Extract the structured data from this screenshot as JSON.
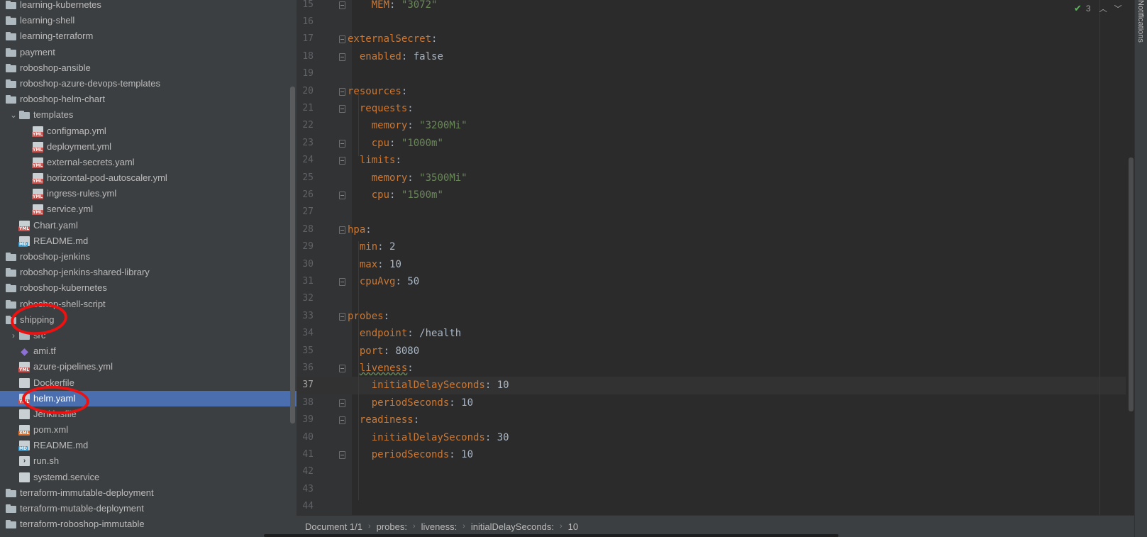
{
  "tree": {
    "rows": [
      {
        "label": "learning-kubernetes",
        "type": "folder",
        "depth": 0,
        "expandable": false
      },
      {
        "label": "learning-shell",
        "type": "folder",
        "depth": 0,
        "expandable": false
      },
      {
        "label": "learning-terraform",
        "type": "folder",
        "depth": 0,
        "expandable": false
      },
      {
        "label": "payment",
        "type": "folder",
        "depth": 0,
        "expandable": false
      },
      {
        "label": "roboshop-ansible",
        "type": "folder",
        "depth": 0,
        "expandable": false
      },
      {
        "label": "roboshop-azure-devops-templates",
        "type": "folder",
        "depth": 0,
        "expandable": false
      },
      {
        "label": "roboshop-helm-chart",
        "type": "folder",
        "depth": 0,
        "expandable": false
      },
      {
        "label": "templates",
        "type": "folder",
        "depth": 1,
        "expandable": true,
        "expanded": true
      },
      {
        "label": "configmap.yml",
        "type": "yml",
        "depth": 2
      },
      {
        "label": "deployment.yml",
        "type": "yml",
        "depth": 2
      },
      {
        "label": "external-secrets.yaml",
        "type": "yml",
        "depth": 2
      },
      {
        "label": "horizontal-pod-autoscaler.yml",
        "type": "yml",
        "depth": 2
      },
      {
        "label": "ingress-rules.yml",
        "type": "yml",
        "depth": 2
      },
      {
        "label": "service.yml",
        "type": "yml",
        "depth": 2
      },
      {
        "label": "Chart.yaml",
        "type": "yml",
        "depth": 1
      },
      {
        "label": "README.md",
        "type": "md",
        "depth": 1
      },
      {
        "label": "roboshop-jenkins",
        "type": "folder",
        "depth": 0
      },
      {
        "label": "roboshop-jenkins-shared-library",
        "type": "folder",
        "depth": 0
      },
      {
        "label": "roboshop-kubernetes",
        "type": "folder",
        "depth": 0
      },
      {
        "label": "roboshop-shell-script",
        "type": "folder",
        "depth": 0
      },
      {
        "label": "shipping",
        "type": "folder",
        "depth": 0
      },
      {
        "label": "src",
        "type": "folder",
        "depth": 1,
        "expandable": true,
        "expanded": false
      },
      {
        "label": "ami.tf",
        "type": "tf",
        "depth": 1
      },
      {
        "label": "azure-pipelines.yml",
        "type": "yml",
        "depth": 1
      },
      {
        "label": "Dockerfile",
        "type": "file",
        "depth": 1
      },
      {
        "label": "helm.yaml",
        "type": "yml",
        "depth": 1,
        "selected": true
      },
      {
        "label": "Jenkinsfile",
        "type": "file",
        "depth": 1
      },
      {
        "label": "pom.xml",
        "type": "xml",
        "depth": 1
      },
      {
        "label": "README.md",
        "type": "md",
        "depth": 1
      },
      {
        "label": "run.sh",
        "type": "sh",
        "depth": 1
      },
      {
        "label": "systemd.service",
        "type": "file",
        "depth": 1
      },
      {
        "label": "terraform-immutable-deployment",
        "type": "folder",
        "depth": 0
      },
      {
        "label": "terraform-mutable-deployment",
        "type": "folder",
        "depth": 0
      },
      {
        "label": "terraform-roboshop-immutable",
        "type": "folder",
        "depth": 0
      }
    ]
  },
  "editor": {
    "current_line": 37,
    "lines": [
      {
        "n": 15,
        "indent": 2,
        "key": "MEM",
        "value": "\"3072\"",
        "vtype": "s",
        "fold": true
      },
      {
        "n": 16
      },
      {
        "n": 17,
        "indent": 0,
        "key": "externalSecret",
        "fold": true
      },
      {
        "n": 18,
        "indent": 1,
        "key": "enabled",
        "value": "false",
        "vtype": "n",
        "fold": true
      },
      {
        "n": 19
      },
      {
        "n": 20,
        "indent": 0,
        "key": "resources",
        "fold": true
      },
      {
        "n": 21,
        "indent": 1,
        "key": "requests",
        "fold": true
      },
      {
        "n": 22,
        "indent": 2,
        "key": "memory",
        "value": "\"3200Mi\"",
        "vtype": "s"
      },
      {
        "n": 23,
        "indent": 2,
        "key": "cpu",
        "value": "\"1000m\"",
        "vtype": "s",
        "fold": true
      },
      {
        "n": 24,
        "indent": 1,
        "key": "limits",
        "fold": true
      },
      {
        "n": 25,
        "indent": 2,
        "key": "memory",
        "value": "\"3500Mi\"",
        "vtype": "s"
      },
      {
        "n": 26,
        "indent": 2,
        "key": "cpu",
        "value": "\"1500m\"",
        "vtype": "s",
        "fold": true
      },
      {
        "n": 27
      },
      {
        "n": 28,
        "indent": 0,
        "key": "hpa",
        "fold": true
      },
      {
        "n": 29,
        "indent": 1,
        "key": "min",
        "value": "2",
        "vtype": "n"
      },
      {
        "n": 30,
        "indent": 1,
        "key": "max",
        "value": "10",
        "vtype": "n"
      },
      {
        "n": 31,
        "indent": 1,
        "key": "cpuAvg",
        "value": "50",
        "vtype": "n",
        "fold": true
      },
      {
        "n": 32
      },
      {
        "n": 33,
        "indent": 0,
        "key": "probes",
        "fold": true
      },
      {
        "n": 34,
        "indent": 1,
        "key": "endpoint",
        "value": "/health",
        "vtype": "n"
      },
      {
        "n": 35,
        "indent": 1,
        "key": "port",
        "value": "8080",
        "vtype": "n"
      },
      {
        "n": 36,
        "indent": 1,
        "key": "liveness",
        "fold": true,
        "squiggle": true
      },
      {
        "n": 37,
        "indent": 2,
        "key": "initialDelaySeconds",
        "value": "10",
        "vtype": "n"
      },
      {
        "n": 38,
        "indent": 2,
        "key": "periodSeconds",
        "value": "10",
        "vtype": "n",
        "fold": true
      },
      {
        "n": 39,
        "indent": 1,
        "key": "readiness",
        "fold": true
      },
      {
        "n": 40,
        "indent": 2,
        "key": "initialDelaySeconds",
        "value": "30",
        "vtype": "n"
      },
      {
        "n": 41,
        "indent": 2,
        "key": "periodSeconds",
        "value": "10",
        "vtype": "n",
        "fold": true
      },
      {
        "n": 42
      },
      {
        "n": 43
      },
      {
        "n": 44
      }
    ],
    "inspection": {
      "count": "3",
      "icon": "check-icon"
    }
  },
  "notifications_label": "Notifications",
  "breadcrumb": {
    "document": "Document 1/1",
    "items": [
      "probes:",
      "liveness:",
      "initialDelaySeconds:",
      "10"
    ]
  },
  "colors": {
    "tree_bg": "#3c3f41",
    "editor_bg": "#2b2b2b",
    "selection": "#4b6eaf",
    "yaml_key": "#cc7832",
    "yaml_string": "#6a8759",
    "annotation": "#ee1111"
  }
}
